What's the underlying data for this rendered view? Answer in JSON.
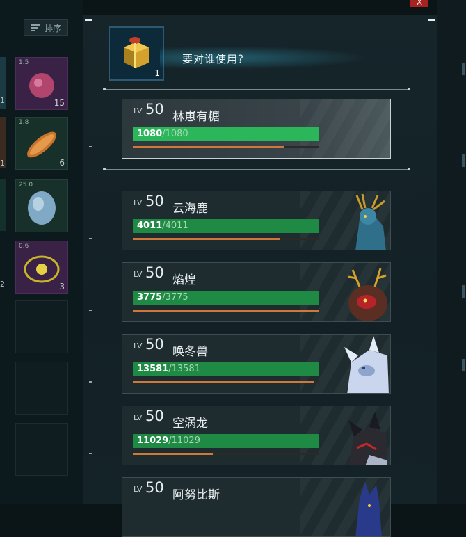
{
  "background": {
    "sort_label": "排序",
    "slots": [
      {
        "weight": "1.5",
        "qty": "15",
        "kind": "purple"
      },
      {
        "weight": "1.8",
        "qty": "6",
        "kind": "green"
      },
      {
        "weight": "25.0",
        "qty": "",
        "kind": "green"
      },
      {
        "weight": "0.6",
        "qty": "3",
        "kind": "purple"
      }
    ],
    "left_edge_numbers": [
      "1",
      "1",
      "2"
    ]
  },
  "close_label": "X",
  "popup": {
    "item": {
      "icon": "gift-box-icon",
      "count": "1"
    },
    "question": "要对谁使用？",
    "player": {
      "lv_prefix": "LV",
      "level": "50",
      "name": "林崽有糖",
      "hp_current": "1080",
      "hp_max": "/1080",
      "xp_fraction": 0.81
    },
    "pals": [
      {
        "lv_prefix": "LV",
        "level": "50",
        "name": "云海鹿",
        "hp_current": "4011",
        "hp_max": "/4011",
        "xp_fraction": 0.79,
        "icon": "dragon-deer-pal-icon"
      },
      {
        "lv_prefix": "LV",
        "level": "50",
        "name": "焰煌",
        "hp_current": "3775",
        "hp_max": "/3775",
        "xp_fraction": 1.0,
        "icon": "fire-antler-pal-icon"
      },
      {
        "lv_prefix": "LV",
        "level": "50",
        "name": "唤冬兽",
        "hp_current": "13581",
        "hp_max": "/13581",
        "xp_fraction": 0.97,
        "icon": "ice-beast-pal-icon"
      },
      {
        "lv_prefix": "LV",
        "level": "50",
        "name": "空涡龙",
        "hp_current": "11029",
        "hp_max": "/11029",
        "xp_fraction": 0.43,
        "icon": "void-dragon-pal-icon"
      },
      {
        "lv_prefix": "LV",
        "level": "50",
        "name": "阿努比斯",
        "hp_current": "",
        "hp_max": "",
        "xp_fraction": 0,
        "icon": "anubis-pal-icon"
      }
    ]
  },
  "colors": {
    "hp_bar": "#1f8a44",
    "hp_bar_selected": "#2bb65a",
    "xp_bar": "#d0783a",
    "item_border": "#2d5a72",
    "close": "#a82222"
  }
}
